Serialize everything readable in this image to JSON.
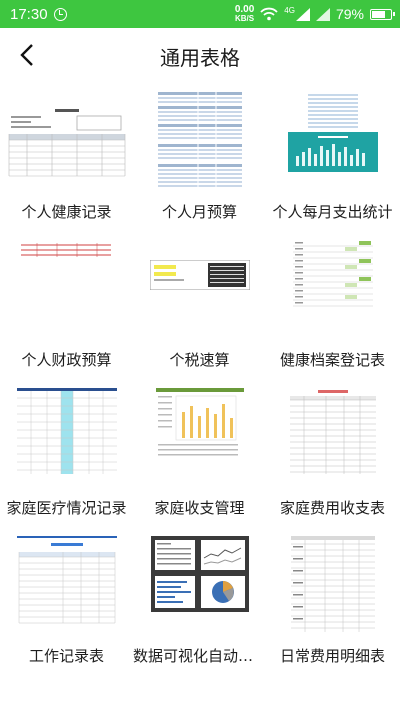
{
  "statusbar": {
    "time": "17:30",
    "net_speed_value": "0.00",
    "net_speed_unit": "KB/S",
    "signal_label": "4G",
    "battery_pct": "79%",
    "battery_level": 0.79,
    "alarm_icon": "alarm-icon",
    "wifi_icon": "wifi-icon",
    "signal_icon": "signal-icon",
    "battery_icon": "battery-icon"
  },
  "navbar": {
    "back_icon": "chevron-left-icon",
    "title": "通用表格"
  },
  "templates": [
    {
      "label": "个人健康记录"
    },
    {
      "label": "个人月预算"
    },
    {
      "label": "个人每月支出统计"
    },
    {
      "label": "个人财政预算"
    },
    {
      "label": "个税速算"
    },
    {
      "label": "健康档案登记表"
    },
    {
      "label": "家庭医疗情况记录"
    },
    {
      "label": "家庭收支管理"
    },
    {
      "label": "家庭费用收支表"
    },
    {
      "label": "工作记录表"
    },
    {
      "label": "数据可视化自动分..."
    },
    {
      "label": "日常费用明细表"
    }
  ],
  "colors": {
    "statusbar": "#3ec640",
    "accent_blue": "#1f5fb0",
    "chart_teal": "#1fa3a3"
  }
}
